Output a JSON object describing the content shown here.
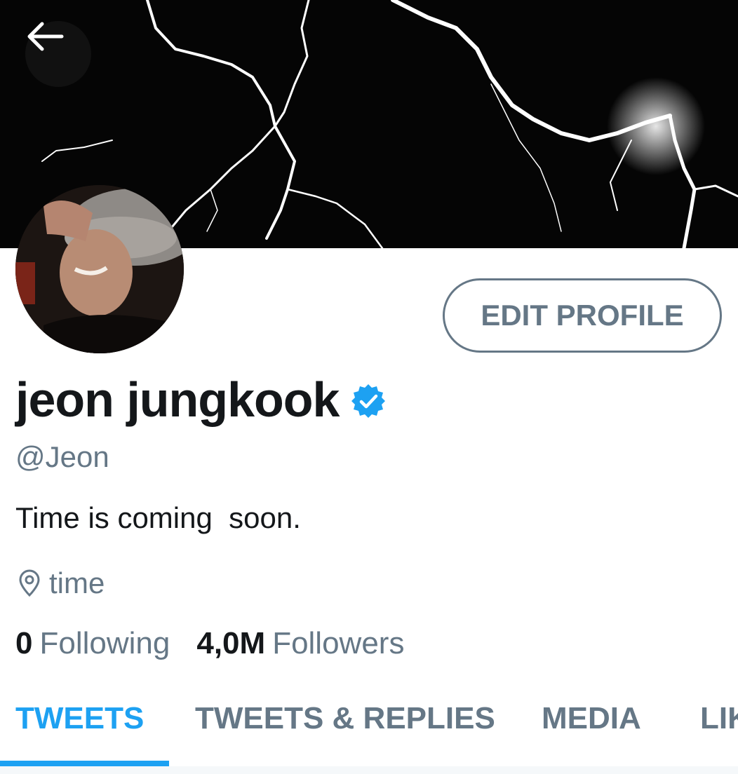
{
  "colors": {
    "accent": "#1da1f2",
    "secondary_text": "#657786",
    "primary_text": "#14171a",
    "banner_background": "#050505"
  },
  "header": {
    "back_icon": "arrow-left-icon"
  },
  "profile": {
    "display_name": "jeon jungkook",
    "verified_icon": "verified-badge-icon",
    "handle": "@Jeon",
    "bio": "Time is coming  soon.",
    "location_icon": "location-pin-icon",
    "location": "time",
    "edit_button_label": "EDIT PROFILE"
  },
  "stats": {
    "following_count": "0",
    "following_label": "Following",
    "followers_count": "4,0M",
    "followers_label": "Followers"
  },
  "tabs": [
    {
      "label": "TWEETS",
      "active": true
    },
    {
      "label": "TWEETS & REPLIES",
      "active": false
    },
    {
      "label": "MEDIA",
      "active": false
    },
    {
      "label": "LIKES",
      "active": false
    }
  ]
}
